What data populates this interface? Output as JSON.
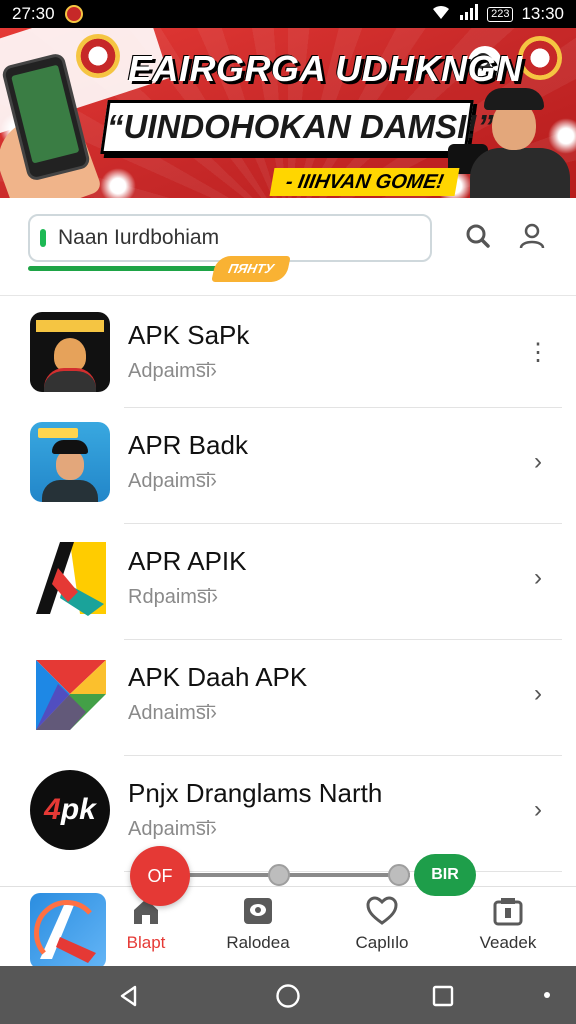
{
  "status_bar": {
    "time_left": "27:30",
    "battery": "223",
    "time_right": "13:30"
  },
  "banner": {
    "title": "EAIRGRGA UDHKNGN",
    "slogan": "“UINDOHOKAN DAMSI!”",
    "subtitle": "- IIIHVAN GOME!"
  },
  "search": {
    "placeholder": "Naan Iurdbohiam",
    "badge": "ПЯНТУ"
  },
  "apps": [
    {
      "name": "APK SaPk",
      "subtitle": "Adpaims͞i›",
      "icon": "apk-sapk-icon",
      "action": "⋮"
    },
    {
      "name": "APR Badk",
      "subtitle": "Adpaims͞i›",
      "icon": "apr-badk-icon",
      "action": "›"
    },
    {
      "name": "APR APIK",
      "subtitle": "Rdpaims͞i›",
      "icon": "apr-apik-icon",
      "action": "›"
    },
    {
      "name": "APK Daah APK",
      "subtitle": "Adnaims͞i›",
      "icon": "apk-daah-icon",
      "action": "›"
    },
    {
      "name": "Pnjx Dranglams Narth",
      "subtitle": "Adpaims͞i›",
      "icon": "apk-logo-icon",
      "action": "›"
    }
  ],
  "apk_logo_text": {
    "a": "4",
    "b": "pk"
  },
  "slider": {
    "off_label": "OF",
    "on_label": "BIR",
    "state": "on"
  },
  "bottom_nav": [
    {
      "label": "Blapt",
      "icon": "home-icon",
      "active": true
    },
    {
      "label": "Ralodea",
      "icon": "message-icon",
      "active": false
    },
    {
      "label": "Caplılo",
      "icon": "heart-icon",
      "active": false
    },
    {
      "label": "Veadek",
      "icon": "wallet-icon",
      "active": false
    }
  ],
  "colors": {
    "brand_red": "#e53935",
    "accent_green": "#1e9e4a",
    "accent_yellow": "#f9b233"
  }
}
